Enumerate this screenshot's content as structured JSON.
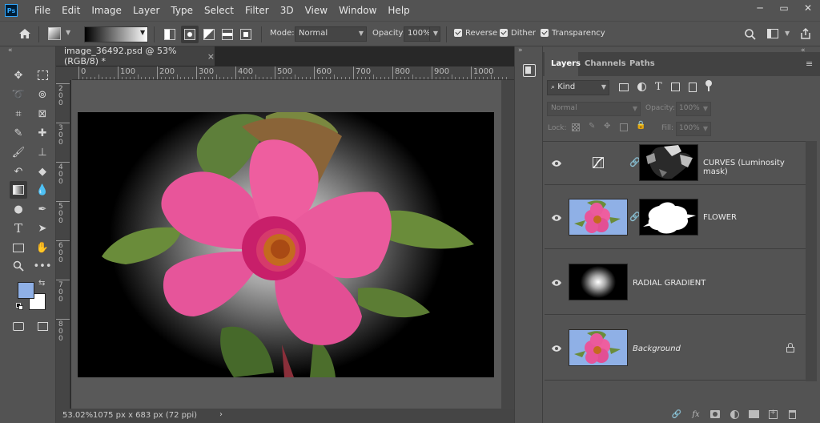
{
  "app": {
    "logo_text": "Ps"
  },
  "menu": [
    "File",
    "Edit",
    "Image",
    "Layer",
    "Type",
    "Select",
    "Filter",
    "3D",
    "View",
    "Window",
    "Help"
  ],
  "window_controls": {
    "restore": "▭",
    "minimize": "─",
    "close": "✕"
  },
  "options": {
    "mode_label": "Mode:",
    "mode_value": "Normal",
    "opacity_label": "Opacity:",
    "opacity_value": "100%",
    "reverse_label": "Reverse",
    "dither_label": "Dither",
    "transparency_label": "Transparency"
  },
  "document": {
    "tab_title": "image_36492.psd @ 53% (RGB/8) *",
    "close_glyph": "×",
    "ruler_top": [
      "0",
      "100",
      "200",
      "300",
      "400",
      "500",
      "600",
      "700",
      "800",
      "900",
      "1000"
    ],
    "ruler_left": [
      "2\n0\n0",
      "3\n0\n0",
      "4\n0\n0",
      "5\n0\n0",
      "6\n0\n0",
      "7\n0\n0",
      "8\n0\n0"
    ],
    "zoom": "53.02%",
    "doc_info": "1075 px x 683 px (72 ppi)",
    "doc_info_arrow": "›"
  },
  "layers_panel": {
    "tabs": [
      "Layers",
      "Channels",
      "Paths"
    ],
    "filter_kind": "Kind",
    "blend_mode": "Normal",
    "opacity_label": "Opacity:",
    "opacity_value": "100%",
    "lock_label": "Lock:",
    "fill_label": "Fill:",
    "fill_value": "100%",
    "layers": [
      {
        "name": "CURVES (Luminosity mask)",
        "type": "adjustment",
        "visible": true
      },
      {
        "name": "FLOWER",
        "type": "masked",
        "visible": true
      },
      {
        "name": "RADIAL GRADIENT",
        "type": "gradient",
        "visible": true
      },
      {
        "name": "Background",
        "type": "background",
        "visible": true,
        "locked": true
      }
    ],
    "footer_fx": "fx"
  },
  "colors": {
    "foreground": "#8fb0e6",
    "background": "#ffffff",
    "ui_bg": "#535353",
    "accent_pink": "#e8559a"
  }
}
